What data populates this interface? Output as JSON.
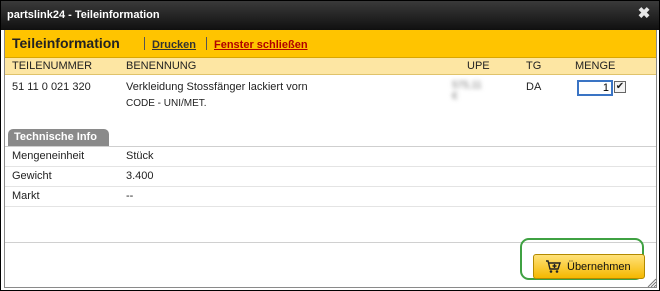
{
  "window": {
    "title": "partslink24 - Teileinformation",
    "close_icon": "close-icon"
  },
  "header": {
    "title": "Teileinformation",
    "print_link": "Drucken",
    "close_link": "Fenster schließen"
  },
  "columns": {
    "part_number": "TEILENUMMER",
    "description": "BENENNUNG",
    "upe": "UPE",
    "tg": "TG",
    "quantity": "MENGE"
  },
  "part": {
    "number": "51 11 0 021 320",
    "description": "Verkleidung Stossfänger lackiert vorn",
    "code": "CODE - UNI/MET.",
    "upe_blurred": "575,11 €",
    "tg": "DA",
    "quantity": "1",
    "selected": true
  },
  "tech_info": {
    "tab_label": "Technische Info",
    "rows": [
      {
        "label": "Mengeneinheit",
        "value": "Stück"
      },
      {
        "label": "Gewicht",
        "value": "3.400"
      },
      {
        "label": "Markt",
        "value": "--"
      }
    ]
  },
  "footer": {
    "accept_button": "Übernehmen",
    "accept_icon": "cart-add-icon"
  },
  "colors": {
    "header_yellow": "#ffc400",
    "column_header_bg": "#fde6a3",
    "link_red": "#b00000",
    "highlight_green": "#3fa142",
    "titlebar_dark": "#1a1a1a"
  }
}
